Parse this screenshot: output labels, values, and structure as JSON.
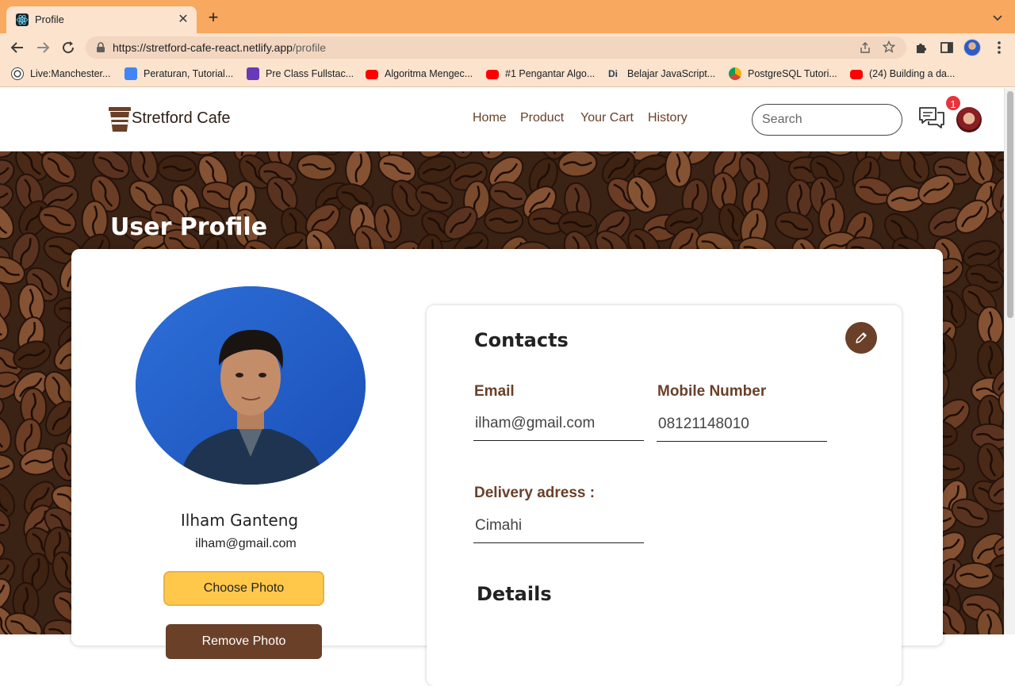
{
  "browser": {
    "tab_title": "Profile",
    "url_host": "https://stretford-cafe-react.netlify.app",
    "url_path": "/profile",
    "bookmarks": [
      {
        "label": "Live:Manchester...",
        "icon": "football-icon",
        "color": "#444444"
      },
      {
        "label": "Peraturan, Tutorial...",
        "icon": "google-docs-icon",
        "color": "#4285f4"
      },
      {
        "label": "Pre Class Fullstac...",
        "icon": "google-forms-icon",
        "color": "#673ab7"
      },
      {
        "label": "Algoritma Mengec...",
        "icon": "youtube-icon",
        "color": "#ff0000"
      },
      {
        "label": "#1 Pengantar Algo...",
        "icon": "youtube-icon",
        "color": "#ff0000"
      },
      {
        "label": "Belajar JavaScript...",
        "icon": "dicoding-icon",
        "color": "#2d3e50"
      },
      {
        "label": "PostgreSQL Tutori...",
        "icon": "chrome-web-icon",
        "color": "#f4b400"
      },
      {
        "label": "(24) Building a da...",
        "icon": "youtube-icon",
        "color": "#ff0000"
      }
    ]
  },
  "site": {
    "brand": "Stretford Cafe",
    "nav": [
      "Home",
      "Product",
      "Your Cart",
      "History"
    ],
    "search_placeholder": "Search",
    "notification_count": "1"
  },
  "profile": {
    "page_title": "User Profile",
    "name": "Ilham Ganteng",
    "email": "ilham@gmail.com",
    "choose_photo_label": "Choose Photo",
    "remove_photo_label": "Remove Photo"
  },
  "contacts": {
    "title": "Contacts",
    "email_label": "Email",
    "email_value": "ilham@gmail.com",
    "mobile_label": "Mobile Number",
    "mobile_value": "08121148010",
    "address_label": "Delivery adress :",
    "address_value": "Cimahi",
    "details_title": "Details"
  },
  "colors": {
    "tab_strip": "#f9a85f",
    "toolbar": "#fbe3cd",
    "accent_brown": "#6a4029",
    "button_yellow": "#ffc84a",
    "badge_red": "#e8333c"
  }
}
